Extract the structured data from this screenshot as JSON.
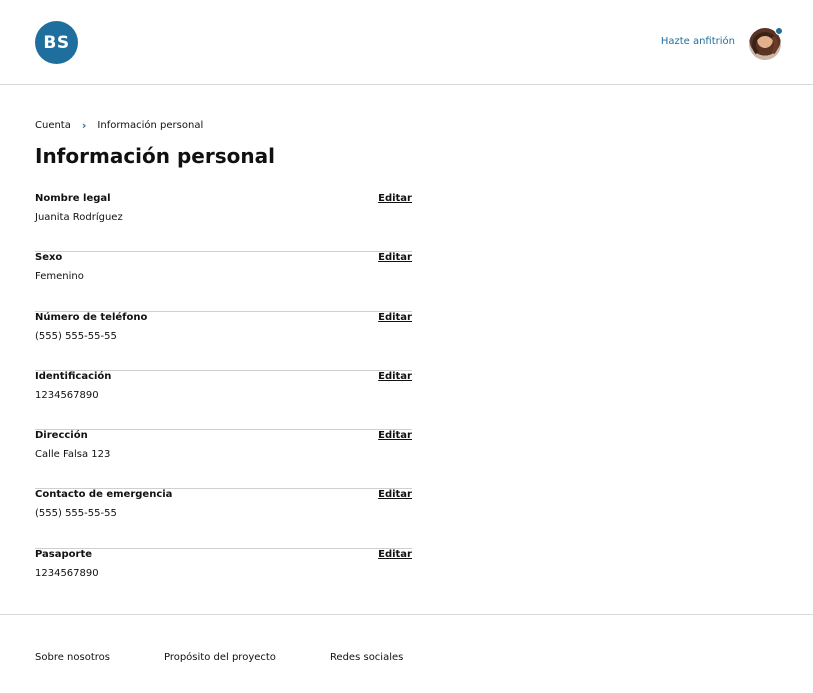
{
  "header": {
    "logo_text": "BS",
    "host_link": "Hazte anfitrión",
    "notification_count": "1"
  },
  "breadcrumb": {
    "items": [
      "Cuenta",
      "Información personal"
    ],
    "separator": "›"
  },
  "page_title": "Información personal",
  "edit_label": "Editar",
  "fields": [
    {
      "label": "Nombre legal",
      "value": "Juanita Rodríguez"
    },
    {
      "label": "Sexo",
      "value": "Femenino"
    },
    {
      "label": "Número de teléfono",
      "value": "(555) 555-55-55"
    },
    {
      "label": "Identificación",
      "value": "1234567890"
    },
    {
      "label": "Dirección",
      "value": "Calle Falsa 123"
    },
    {
      "label": "Contacto de emergencia",
      "value": "(555) 555-55-55"
    },
    {
      "label": "Pasaporte",
      "value": "1234567890"
    }
  ],
  "footer": {
    "links": [
      "Sobre nosotros",
      "Propósito del proyecto",
      "Redes sociales"
    ]
  },
  "colors": {
    "accent": "#1f6f9e"
  }
}
